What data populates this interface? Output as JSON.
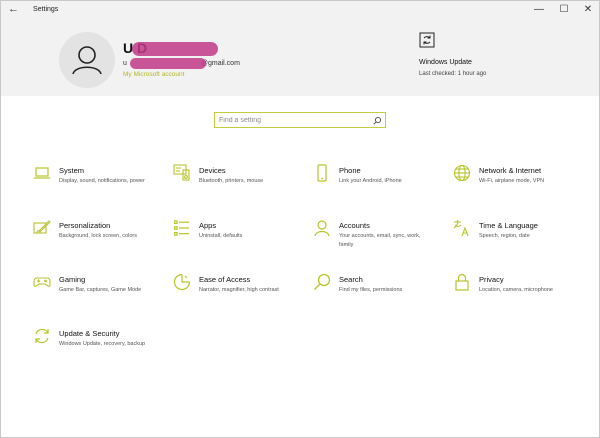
{
  "window": {
    "title": "Settings",
    "back_glyph": "←",
    "min_glyph": "—",
    "max_glyph": "☐",
    "close_glyph": "✕"
  },
  "header": {
    "user_name": "U",
    "user_name_tail": "D",
    "email_suffix": "@gmail.com",
    "email_prefix": "u",
    "account_link": "My Microsoft account",
    "windows_update": {
      "title": "Windows Update",
      "status": "Last checked: 1 hour ago"
    }
  },
  "search": {
    "placeholder": "Find a setting"
  },
  "tiles": [
    {
      "title": "System",
      "desc": "Display, sound, notifications, power",
      "icon": "laptop-icon"
    },
    {
      "title": "Devices",
      "desc": "Bluetooth, printers, mouse",
      "icon": "devices-icon"
    },
    {
      "title": "Phone",
      "desc": "Link your Android, iPhone",
      "icon": "phone-icon"
    },
    {
      "title": "Network & Internet",
      "desc": "Wi-Fi, airplane mode, VPN",
      "icon": "globe-icon"
    },
    {
      "title": "Personalization",
      "desc": "Background, lock screen, colors",
      "icon": "personalization-icon"
    },
    {
      "title": "Apps",
      "desc": "Uninstall, defaults",
      "icon": "apps-list-icon"
    },
    {
      "title": "Accounts",
      "desc": "Your accounts, email, sync, work, family",
      "icon": "person-icon"
    },
    {
      "title": "Time & Language",
      "desc": "Speech, region, date",
      "icon": "time-language-icon"
    },
    {
      "title": "Gaming",
      "desc": "Game Bar, captures, Game Mode",
      "icon": "gamepad-icon"
    },
    {
      "title": "Ease of Access",
      "desc": "Narrator, magnifier, high contrast",
      "icon": "ease-of-access-icon"
    },
    {
      "title": "Search",
      "desc": "Find my files, permissions",
      "icon": "magnifier-icon"
    },
    {
      "title": "Privacy",
      "desc": "Location, camera, microphone",
      "icon": "lock-icon"
    },
    {
      "title": "Update & Security",
      "desc": "Windows Update, recovery, backup",
      "icon": "sync-icon"
    }
  ],
  "colors": {
    "accent": "#b8c42a",
    "header_bg": "#f2f2f2",
    "redaction": "#c23a8a"
  }
}
